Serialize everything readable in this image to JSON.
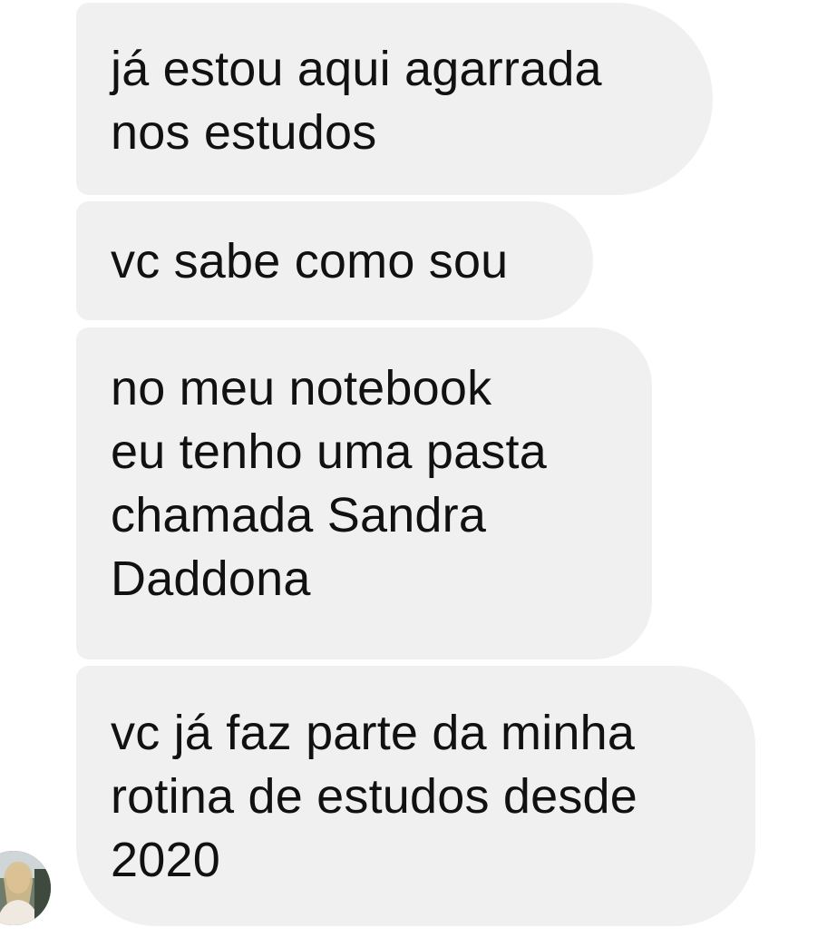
{
  "messages": [
    {
      "lines": [
        "já estou aqui agarrada",
        "nos estudos"
      ]
    },
    {
      "lines": [
        "vc sabe como sou"
      ]
    },
    {
      "lines": [
        "no meu notebook",
        "eu tenho uma pasta",
        "chamada Sandra",
        "Daddona"
      ]
    },
    {
      "lines": [
        "vc já faz parte da minha",
        "rotina de estudos desde",
        "2020"
      ]
    }
  ],
  "sender": {
    "avatar_icon": "profile-photo-icon"
  },
  "colors": {
    "bubble_background": "#f0f0f0",
    "text": "#111111",
    "page_background": "#ffffff"
  }
}
